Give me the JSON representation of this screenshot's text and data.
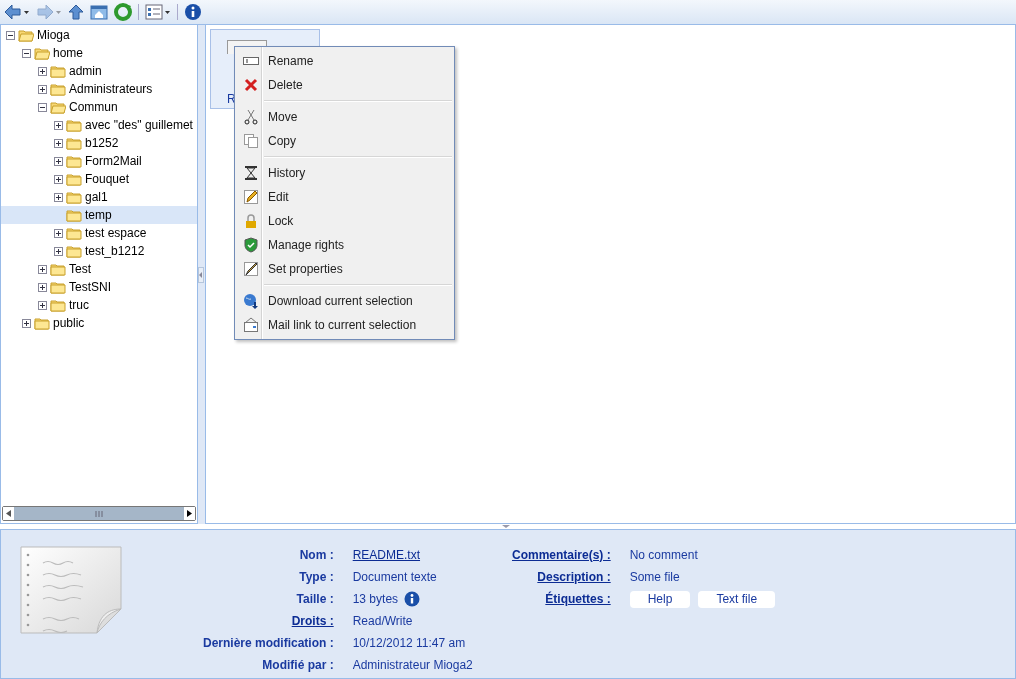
{
  "toolbar": [
    {
      "kind": "back",
      "disabled": false
    },
    {
      "kind": "forward",
      "disabled": true
    },
    {
      "kind": "up",
      "disabled": false
    },
    {
      "kind": "home",
      "disabled": false
    },
    {
      "kind": "refresh",
      "disabled": false
    },
    {
      "kind": "view",
      "disabled": false
    },
    {
      "kind": "info",
      "disabled": false
    }
  ],
  "tree": [
    {
      "label": "Mioga",
      "kind": "folder",
      "expanded": true,
      "selected": false,
      "children": [
        {
          "label": "home",
          "kind": "folder",
          "expanded": true,
          "selected": false,
          "children": [
            {
              "label": "admin",
              "kind": "folder",
              "expanded": false,
              "selected": false
            },
            {
              "label": "Administrateurs",
              "kind": "folder",
              "expanded": false,
              "selected": false
            },
            {
              "label": "Commun",
              "kind": "folder",
              "expanded": true,
              "selected": false,
              "children": [
                {
                  "label": "avec \"des\" guillemet",
                  "kind": "folder",
                  "expanded": false,
                  "selected": false
                },
                {
                  "label": "b1252",
                  "kind": "folder",
                  "expanded": false,
                  "selected": false
                },
                {
                  "label": "Form2Mail",
                  "kind": "folder",
                  "expanded": false,
                  "selected": false
                },
                {
                  "label": "Fouquet",
                  "kind": "folder",
                  "expanded": false,
                  "selected": false
                },
                {
                  "label": "gal1",
                  "kind": "folder",
                  "expanded": false,
                  "selected": false
                },
                {
                  "label": "temp",
                  "kind": "leaf",
                  "expanded": false,
                  "selected": true
                },
                {
                  "label": "test espace",
                  "kind": "folder",
                  "expanded": false,
                  "selected": false
                },
                {
                  "label": "test_b1212",
                  "kind": "folder",
                  "expanded": false,
                  "selected": false
                }
              ]
            },
            {
              "label": "Test",
              "kind": "folder",
              "expanded": false,
              "selected": false
            },
            {
              "label": "TestSNI",
              "kind": "folder",
              "expanded": false,
              "selected": false
            },
            {
              "label": "truc",
              "kind": "folder",
              "expanded": false,
              "selected": false
            }
          ]
        },
        {
          "label": "public",
          "kind": "folder",
          "expanded": false,
          "selected": false
        }
      ]
    }
  ],
  "files": [
    {
      "label": "R",
      "selected": true
    }
  ],
  "context_menu": {
    "groups": [
      [
        {
          "label": "Rename",
          "kind": "rename"
        },
        {
          "label": "Delete",
          "kind": "delete"
        }
      ],
      [
        {
          "label": "Move",
          "kind": "move"
        },
        {
          "label": "Copy",
          "kind": "copy"
        }
      ],
      [
        {
          "label": "History",
          "kind": "history"
        },
        {
          "label": "Edit",
          "kind": "edit"
        },
        {
          "label": "Lock",
          "kind": "lock"
        },
        {
          "label": "Manage rights",
          "kind": "rights"
        },
        {
          "label": "Set properties",
          "kind": "properties"
        }
      ],
      [
        {
          "label": "Download current selection",
          "kind": "download"
        },
        {
          "label": "Mail link to current selection",
          "kind": "mail"
        }
      ]
    ]
  },
  "details": {
    "left": [
      {
        "label": "Nom :",
        "label_link": false,
        "kind": "text",
        "value": "README.txt",
        "value_link": true
      },
      {
        "label": "Type :",
        "label_link": false,
        "kind": "text",
        "value": "Document texte",
        "value_link": false
      },
      {
        "label": "Taille :",
        "label_link": false,
        "kind": "size",
        "value": "13 bytes",
        "value_link": false
      },
      {
        "label": "Droits :",
        "label_link": true,
        "kind": "text",
        "value": "Read/Write",
        "value_link": false
      },
      {
        "label": "Dernière modification :",
        "label_link": false,
        "kind": "text",
        "value": "10/12/2012 11:47 am",
        "value_link": false
      },
      {
        "label": "Modifié par :",
        "label_link": false,
        "kind": "text",
        "value": "Administrateur Mioga2",
        "value_link": false
      }
    ],
    "right": [
      {
        "label": "Commentaire(s) :",
        "label_link": true,
        "kind": "text",
        "value": "No comment",
        "value_link": false
      },
      {
        "label": "Description :",
        "label_link": true,
        "kind": "text",
        "value": "Some file",
        "value_link": false
      },
      {
        "label": "Étiquettes :",
        "label_link": true,
        "kind": "tags",
        "tags": [
          "Help",
          "Text file"
        ]
      }
    ]
  }
}
